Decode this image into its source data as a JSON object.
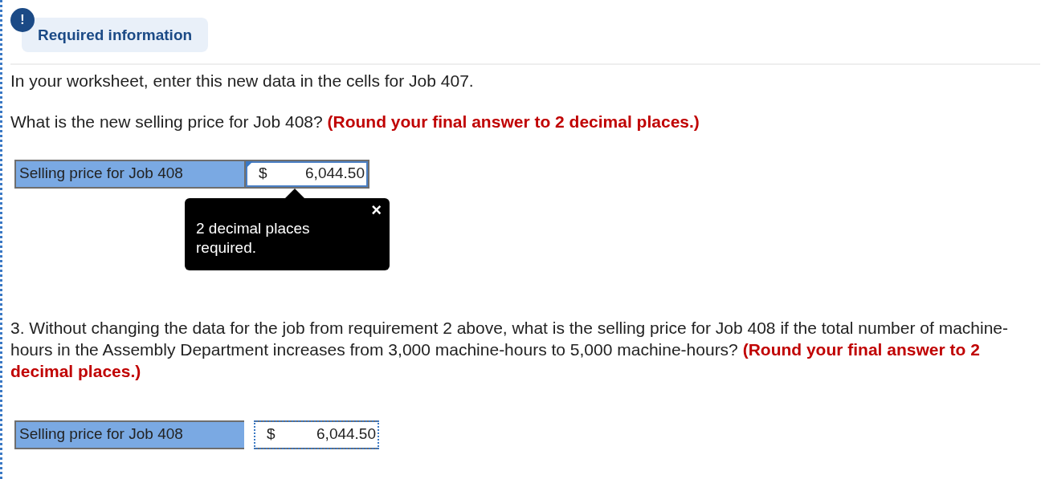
{
  "banner": {
    "icon": "!",
    "title": "Required information"
  },
  "intro": "In your worksheet, enter this new data in the cells for Job 407.",
  "questions": [
    {
      "text": "What is the new selling price for Job 408? **(Round your final answer to 2 decimal places.)**",
      "label": "Selling price for Job 408",
      "currency": "$",
      "value": "6,044.50",
      "focused": true,
      "tooltip": {
        "text": "2 decimal places required.",
        "close": "×"
      }
    },
    {
      "text": "3. Without changing the data for the job from requirement 2 above, what is the selling price for Job 408 if the total number of machine-hours in the Assembly Department increases from 3,000 machine-hours to 5,000 machine-hours? **(Round your final answer to 2 decimal places.)**",
      "label": "Selling price for Job 408",
      "currency": "$",
      "value": "6,044.50",
      "focused": false
    }
  ]
}
